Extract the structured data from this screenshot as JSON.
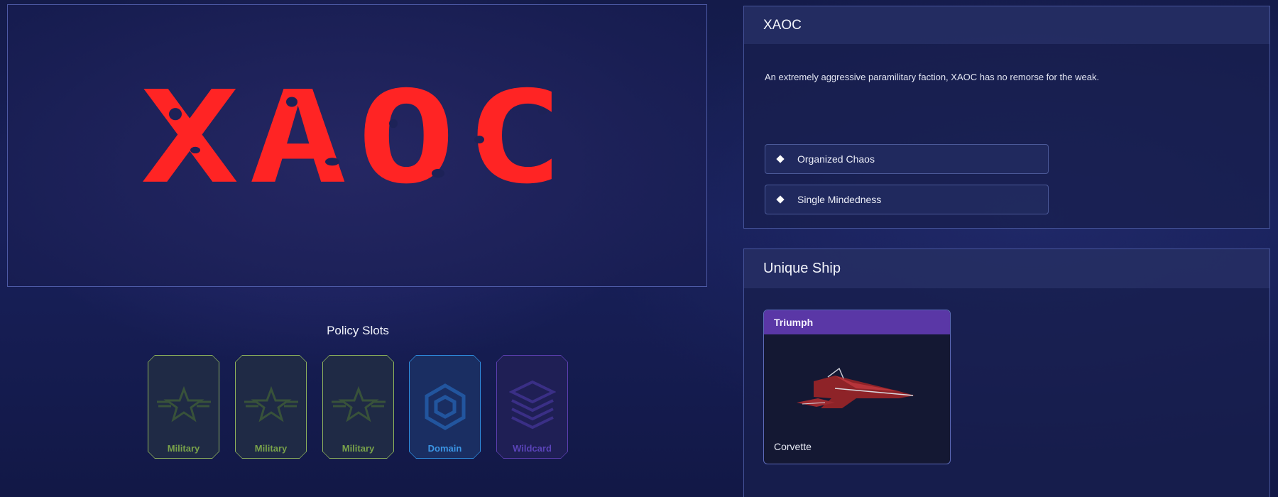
{
  "faction": {
    "logo_text": "XAOC",
    "name": "XAOC",
    "description": "An extremely aggressive paramilitary faction, XAOC has no remorse for the weak.",
    "traits": [
      {
        "label": "Organized Chaos"
      },
      {
        "label": "Single Mindedness"
      }
    ],
    "logo_color": "#ff2424"
  },
  "policy": {
    "title": "Policy Slots",
    "slots": [
      {
        "label": "Military",
        "type": "military",
        "icon": "star-wings-icon",
        "color": "#8fb35c"
      },
      {
        "label": "Military",
        "type": "military",
        "icon": "star-wings-icon",
        "color": "#8fb35c"
      },
      {
        "label": "Military",
        "type": "military",
        "icon": "star-wings-icon",
        "color": "#8fb35c"
      },
      {
        "label": "Domain",
        "type": "domain",
        "icon": "hexagon-icon",
        "color": "#2f8ee0"
      },
      {
        "label": "Wildcard",
        "type": "wildcard",
        "icon": "layers-icon",
        "color": "#5c3fb0"
      }
    ]
  },
  "unique_ship": {
    "title": "Unique Ship",
    "name": "Triumph",
    "class": "Corvette",
    "header_color": "#5a37a6"
  }
}
